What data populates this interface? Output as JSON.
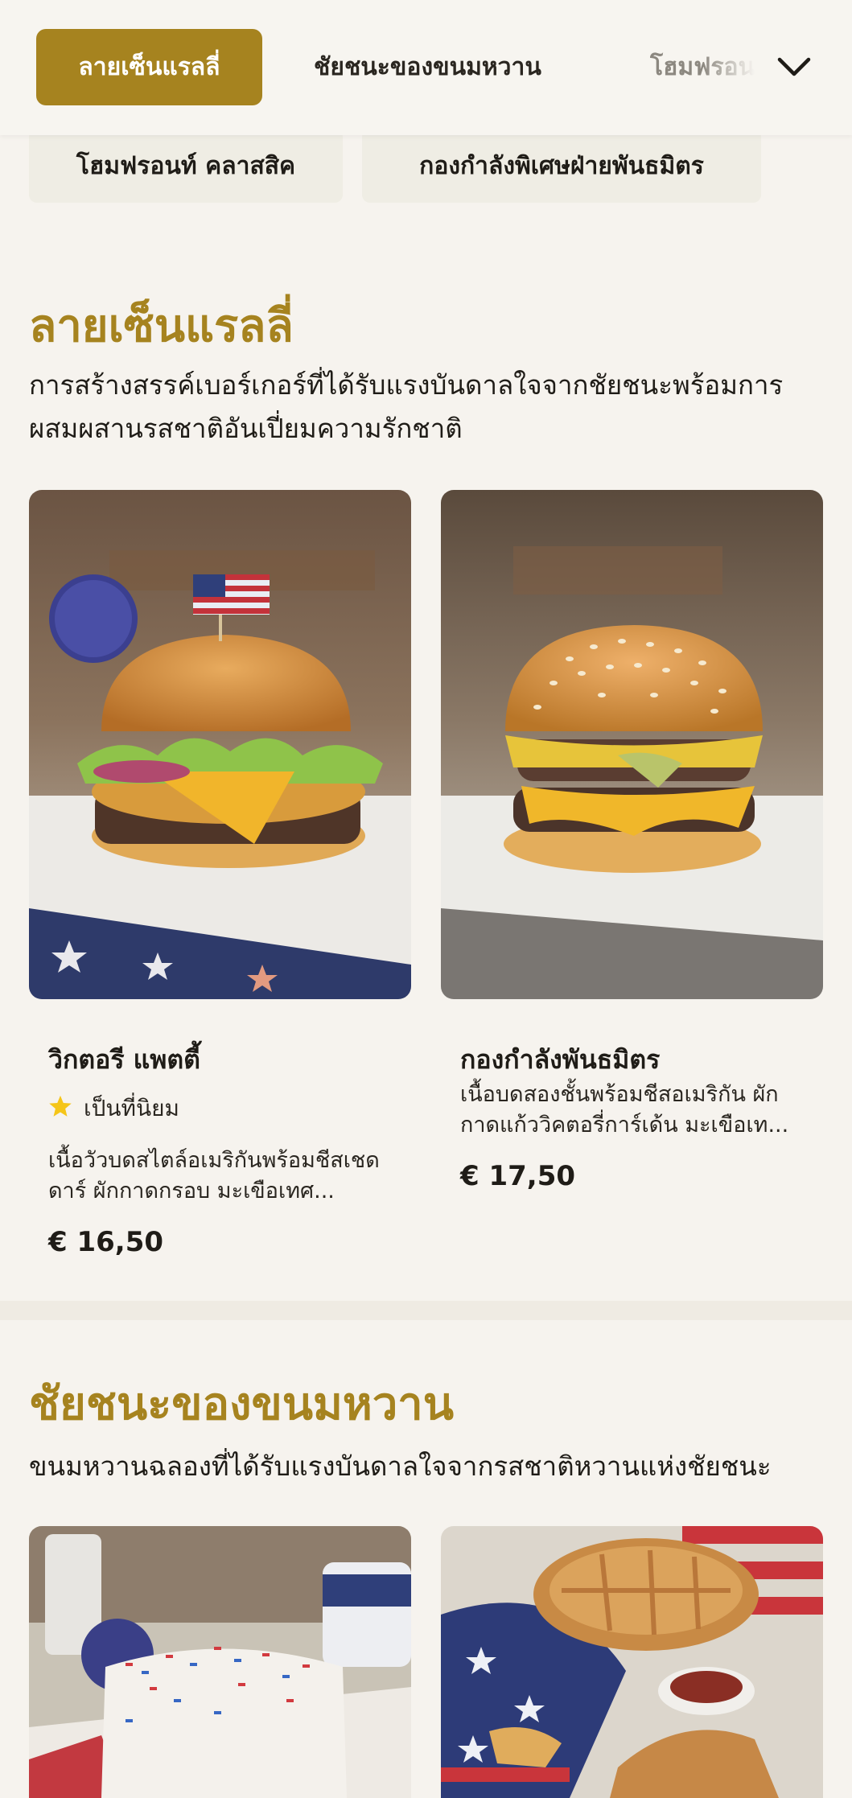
{
  "nav": {
    "tabs": [
      {
        "label": "ลายเซ็นแรลลี่"
      },
      {
        "label": "ชัยชนะของขนมหวาน"
      },
      {
        "label": "โฮมฟรอนท์ คลาสสิค"
      }
    ],
    "chips": [
      {
        "label": "โฮมฟรอนท์ คลาสสิค"
      },
      {
        "label": "กองกำลังพิเศษฝ่ายพันธมิตร"
      }
    ]
  },
  "sections": [
    {
      "title": "ลายเซ็นแรลลี่",
      "description": "การสร้างสรรค์เบอร์เกอร์ที่ได้รับแรงบันดาลใจจากชัยชนะพร้อมการผสมผสานรสชาติอันเปี่ยมความรักชาติ",
      "items": [
        {
          "name": "วิกตอรี แพตตี้",
          "badge": "เป็นที่นิยม",
          "description": "เนื้อวัวบดสไตล์อเมริกันพร้อมชีสเชดดาร์ ผักกาดกรอบ มะเขือเทศ...",
          "price": "€ 16,50"
        },
        {
          "name": "กองกำลังพันธมิตร",
          "description": "เนื้อบดสองชั้นพร้อมชีสอเมริกัน ผักกาดแก้ววิคตอรี่การ์เด้น มะเขือเท...",
          "price": "€ 17,50"
        }
      ]
    },
    {
      "title": "ชัยชนะของขนมหวาน",
      "description": "ขนมหวานฉลองที่ได้รับแรงบันดาลใจจากรสชาติหวานแห่งชัยชนะ"
    }
  ],
  "colors": {
    "accent": "#a6831f",
    "background": "#f6f3ee",
    "star": "#f5c518"
  },
  "icons": {
    "menu_toggle": "chevron-down-icon",
    "badge": "star-icon"
  }
}
